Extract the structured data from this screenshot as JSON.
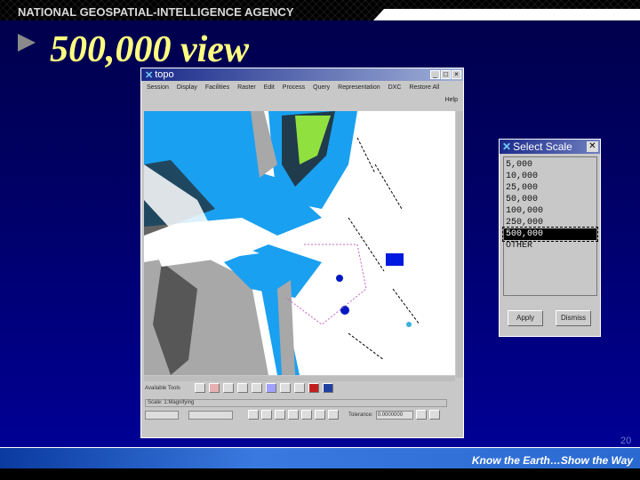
{
  "header": {
    "agency": "NATIONAL GEOSPATIAL-INTELLIGENCE AGENCY"
  },
  "slide": {
    "title": "500,000 view",
    "page_number": "20"
  },
  "footer": {
    "slogan": "Know the Earth…Show the Way"
  },
  "app": {
    "title": "topo",
    "menu": [
      "Session",
      "Display",
      "Facilities",
      "Raster",
      "Edit",
      "Process",
      "Query",
      "Representation",
      "DXC",
      "Restore All"
    ],
    "help": "Help",
    "tools_label": "Available Tools",
    "status": "Scale: 1:Magnifying",
    "coord_label": "Tolerance:",
    "coord_value": "0.0000000"
  },
  "dialog": {
    "title": "Select Scale",
    "options": [
      "5,000",
      "10,000",
      "25,000",
      "50,000",
      "100,000",
      "250,000",
      "500,000",
      "OTHER"
    ],
    "selected": "500,000",
    "apply": "Apply",
    "dismiss": "Dismiss"
  },
  "colors": {
    "water": "#1aa0f0",
    "land": "#a8a8a8",
    "vegetation": "#90e040",
    "title": "#ffff80"
  }
}
